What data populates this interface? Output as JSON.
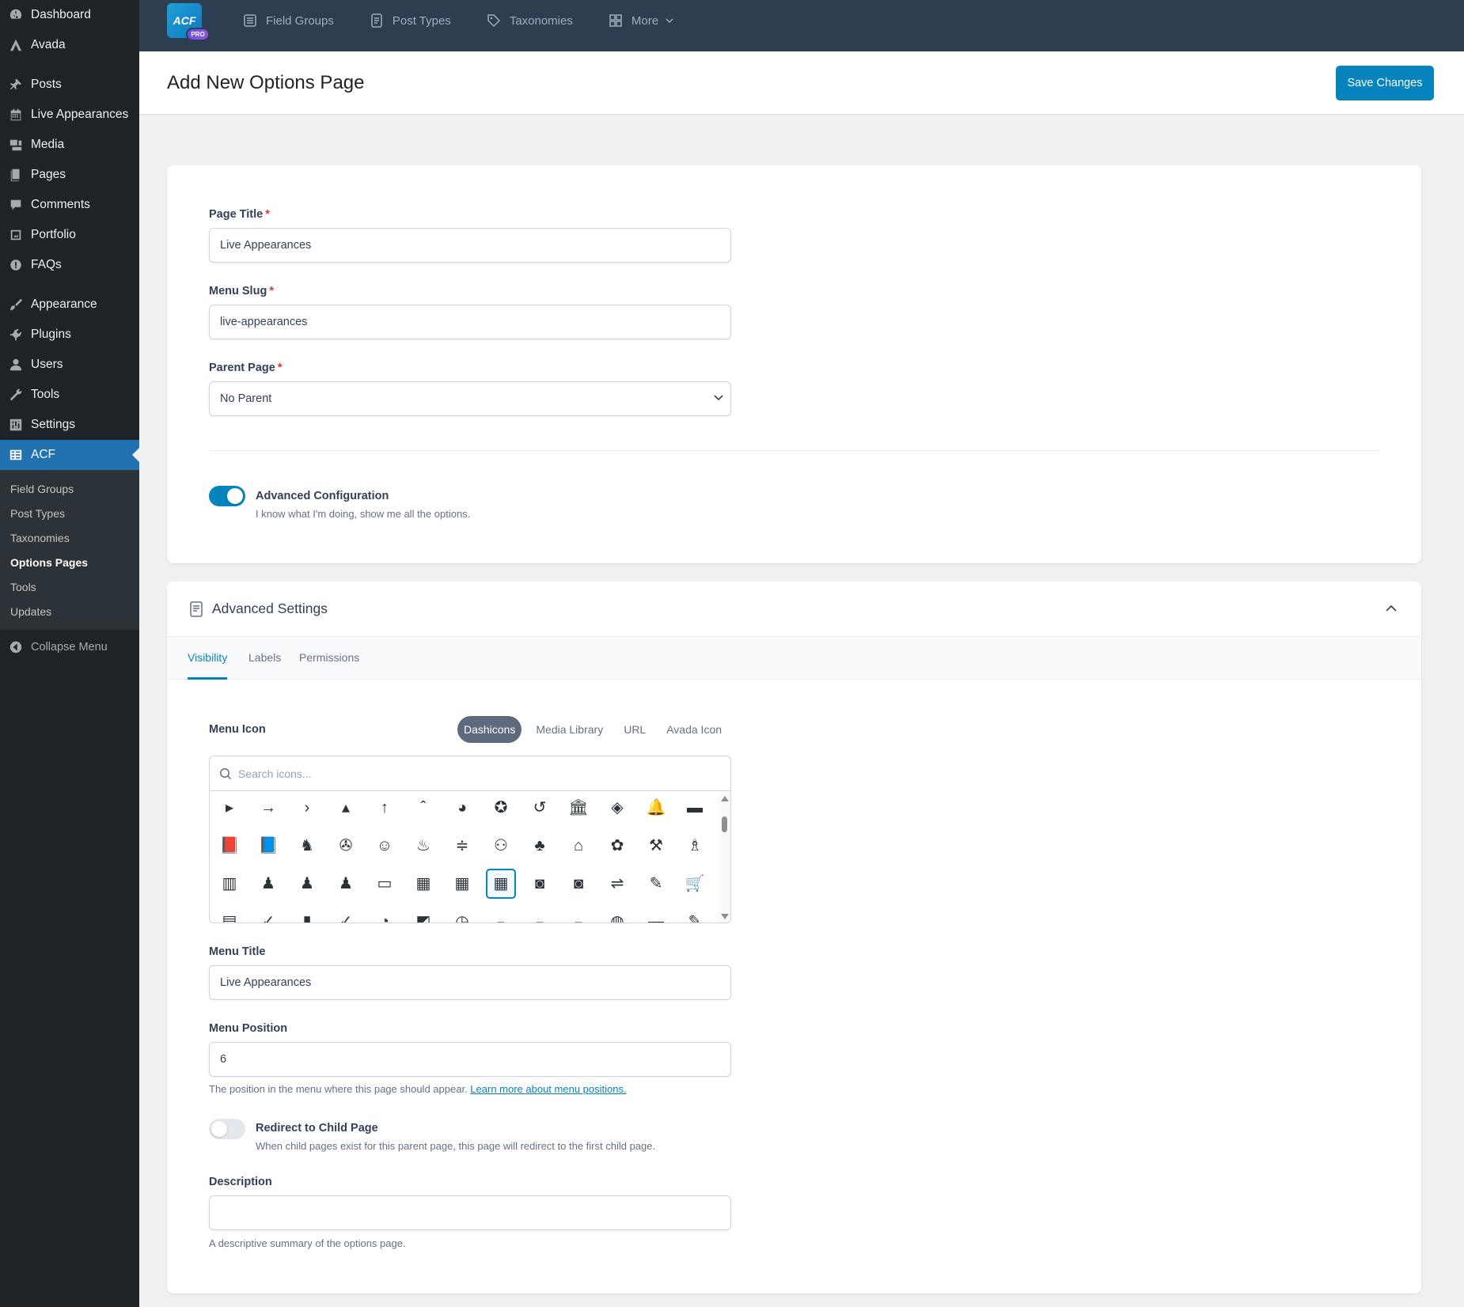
{
  "sidebar": {
    "items": [
      {
        "label": "Dashboard",
        "icon": "dashboard-icon"
      },
      {
        "label": "Avada",
        "icon": "avada-icon"
      },
      {
        "label": "Posts",
        "icon": "pin-icon"
      },
      {
        "label": "Live Appearances",
        "icon": "calendar-icon"
      },
      {
        "label": "Media",
        "icon": "media-icon"
      },
      {
        "label": "Pages",
        "icon": "pages-icon"
      },
      {
        "label": "Comments",
        "icon": "comment-icon"
      },
      {
        "label": "Portfolio",
        "icon": "portfolio-icon"
      },
      {
        "label": "FAQs",
        "icon": "info-icon"
      },
      {
        "label": "Appearance",
        "icon": "brush-icon"
      },
      {
        "label": "Plugins",
        "icon": "plugin-icon"
      },
      {
        "label": "Users",
        "icon": "user-icon"
      },
      {
        "label": "Tools",
        "icon": "wrench-icon"
      },
      {
        "label": "Settings",
        "icon": "settings-icon"
      },
      {
        "label": "ACF",
        "icon": "acf-grid-icon"
      }
    ],
    "submenu": [
      "Field Groups",
      "Post Types",
      "Taxonomies",
      "Options Pages",
      "Tools",
      "Updates"
    ],
    "collapse": "Collapse Menu"
  },
  "topbar": {
    "logo": "ACF",
    "pro": "PRO",
    "nav": [
      "Field Groups",
      "Post Types",
      "Taxonomies",
      "More"
    ]
  },
  "header": {
    "title": "Add New Options Page",
    "save": "Save Changes"
  },
  "form": {
    "page_title": {
      "label": "Page Title",
      "value": "Live Appearances"
    },
    "menu_slug": {
      "label": "Menu Slug",
      "value": "live-appearances"
    },
    "parent_page": {
      "label": "Parent Page",
      "value": "No Parent"
    },
    "required_mark": "*",
    "advanced_config": {
      "title": "Advanced Configuration",
      "desc": "I know what I'm doing, show me all the options.",
      "on": true
    }
  },
  "advanced": {
    "title": "Advanced Settings",
    "tabs": [
      "Visibility",
      "Labels",
      "Permissions"
    ],
    "menu_icon": {
      "label": "Menu Icon",
      "tabs": [
        "Dashicons",
        "Media Library",
        "URL",
        "Avada Icon"
      ],
      "search_placeholder": "Search icons..."
    },
    "menu_title": {
      "label": "Menu Title",
      "value": "Live Appearances"
    },
    "menu_position": {
      "label": "Menu Position",
      "value": "6",
      "help": "The position in the menu where this page should appear.",
      "link": "Learn more about menu positions."
    },
    "redirect": {
      "title": "Redirect to Child Page",
      "desc": "When child pages exist for this parent page, this page will redirect to the first child page.",
      "on": false
    },
    "description": {
      "label": "Description",
      "value": "",
      "help": "A descriptive summary of the options page."
    }
  },
  "icon_grid": [
    [
      "▸",
      "→",
      "›",
      "▴",
      "↑",
      "ˆ",
      "◕",
      "✪",
      "↺",
      "🏛",
      "◈",
      "🔔",
      "▬"
    ],
    [
      "📕",
      "📘",
      "♞",
      "✇",
      "☺",
      "♨",
      "≑",
      "⚇",
      "♣",
      "⌂",
      "✿",
      "⚒",
      "♗"
    ],
    [
      "▥",
      "♟",
      "♟",
      "♟",
      "▭",
      "▦",
      "▦",
      "▦",
      "◙",
      "◙",
      "⇌",
      "✎",
      "🛒"
    ],
    [
      "▤",
      "✓",
      "▮",
      "✓",
      "◔",
      "◩",
      "◷",
      "◒",
      "◒",
      "◒",
      "◍",
      "▬",
      "✎"
    ]
  ],
  "colors": {
    "accent": "#0783be",
    "sidebar": "#1d2327",
    "topbar": "#2c3e50",
    "active_menu": "#2271b1"
  }
}
